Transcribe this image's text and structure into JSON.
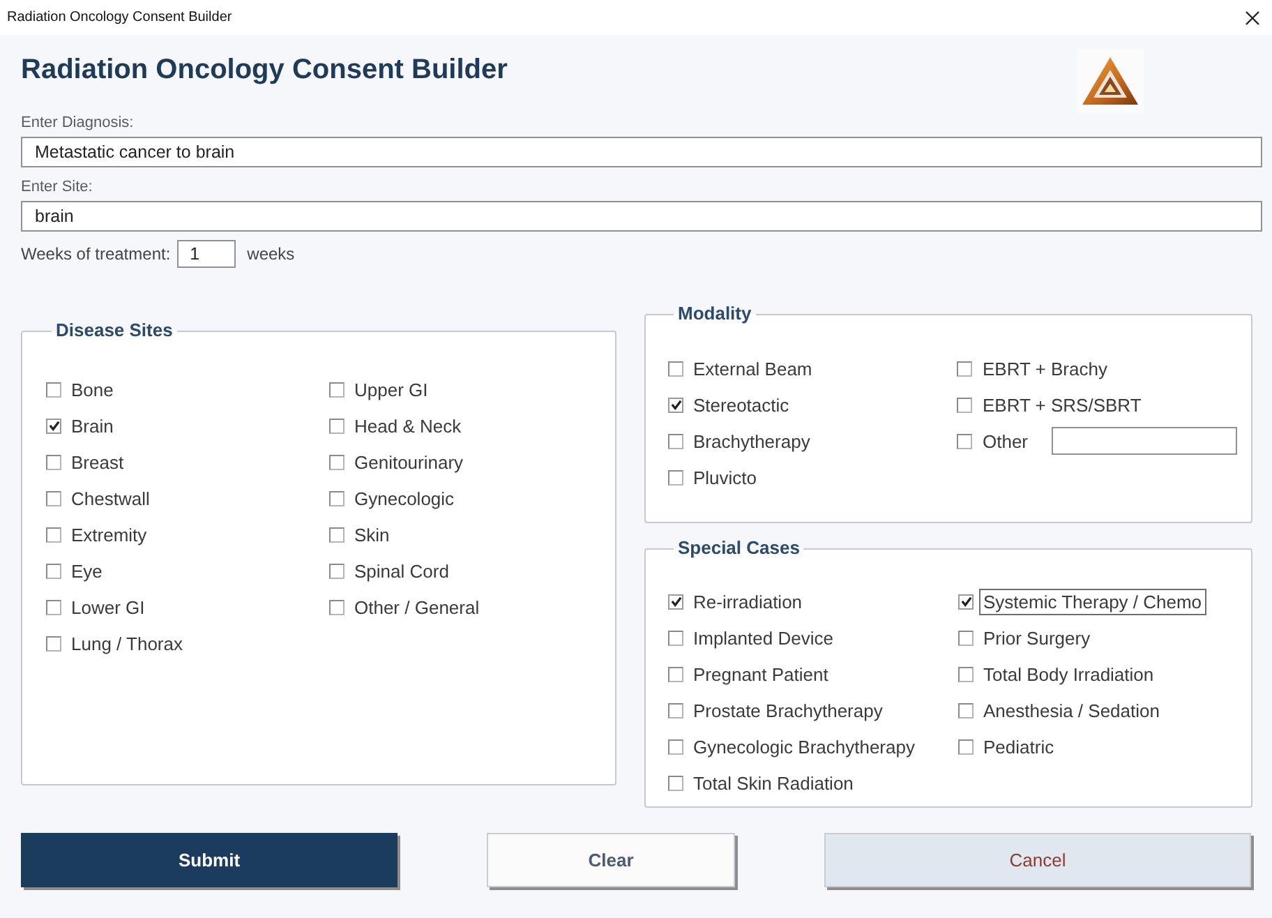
{
  "window": {
    "title": "Radiation Oncology Consent Builder"
  },
  "header": {
    "title": "Radiation Oncology Consent Builder"
  },
  "fields": [
    {
      "label": "Enter Diagnosis:",
      "value": "Metastatic cancer to brain"
    },
    {
      "label": "Enter Site:",
      "value": "brain"
    }
  ],
  "weeks": {
    "label": "Weeks of treatment:",
    "value": "1",
    "unit": "weeks"
  },
  "disease_sites": {
    "title": "Disease Sites",
    "columns": [
      [
        {
          "label": "Bone",
          "checked": false
        },
        {
          "label": "Brain",
          "checked": true
        },
        {
          "label": "Breast",
          "checked": false
        },
        {
          "label": "Chestwall",
          "checked": false
        },
        {
          "label": "Extremity",
          "checked": false
        },
        {
          "label": "Eye",
          "checked": false
        },
        {
          "label": "Lower GI",
          "checked": false
        },
        {
          "label": "Lung / Thorax",
          "checked": false
        }
      ],
      [
        {
          "label": "Upper GI",
          "checked": false
        },
        {
          "label": "Head & Neck",
          "checked": false
        },
        {
          "label": "Genitourinary",
          "checked": false
        },
        {
          "label": "Gynecologic",
          "checked": false
        },
        {
          "label": "Skin",
          "checked": false
        },
        {
          "label": "Spinal Cord",
          "checked": false
        },
        {
          "label": "Other / General",
          "checked": false
        }
      ]
    ]
  },
  "modality": {
    "title": "Modality",
    "columns": [
      [
        {
          "kind": "checkbox",
          "label": "External Beam",
          "checked": false
        },
        {
          "kind": "checkbox",
          "label": "Stereotactic",
          "checked": true
        },
        {
          "kind": "checkbox",
          "label": "Brachytherapy",
          "checked": false
        },
        {
          "kind": "checkbox",
          "label": "Pluvicto",
          "checked": false
        }
      ],
      [
        {
          "kind": "checkbox",
          "label": "EBRT + Brachy",
          "checked": false
        },
        {
          "kind": "checkbox",
          "label": "EBRT + SRS/SBRT",
          "checked": false
        },
        {
          "kind": "checkbox_with_field",
          "label": "Other",
          "checked": false
        }
      ]
    ]
  },
  "special_cases": {
    "title": "Special Cases",
    "columns": [
      [
        {
          "label": "Re-irradiation",
          "checked": true,
          "focused": false
        },
        {
          "label": "Implanted Device",
          "checked": false,
          "focused": false
        },
        {
          "label": "Pregnant Patient",
          "checked": false,
          "focused": false
        },
        {
          "label": "Prostate Brachytherapy",
          "checked": false,
          "focused": false
        },
        {
          "label": "Gynecologic Brachytherapy",
          "checked": false,
          "focused": false
        },
        {
          "label": "Total Skin Radiation",
          "checked": false,
          "focused": false
        }
      ],
      [
        {
          "label": "Systemic Therapy / Chemo",
          "checked": true,
          "focused": true
        },
        {
          "label": "Prior Surgery",
          "checked": false,
          "focused": false
        },
        {
          "label": "Total Body Irradiation",
          "checked": false,
          "focused": false
        },
        {
          "label": "Anesthesia / Sedation",
          "checked": false,
          "focused": false
        },
        {
          "label": "Pediatric",
          "checked": false,
          "focused": false
        }
      ]
    ]
  },
  "buttons": [
    {
      "kind": "primary",
      "label": "Submit"
    },
    {
      "kind": "secondary",
      "label": "Clear"
    },
    {
      "kind": "cancel",
      "label": "Cancel"
    }
  ]
}
